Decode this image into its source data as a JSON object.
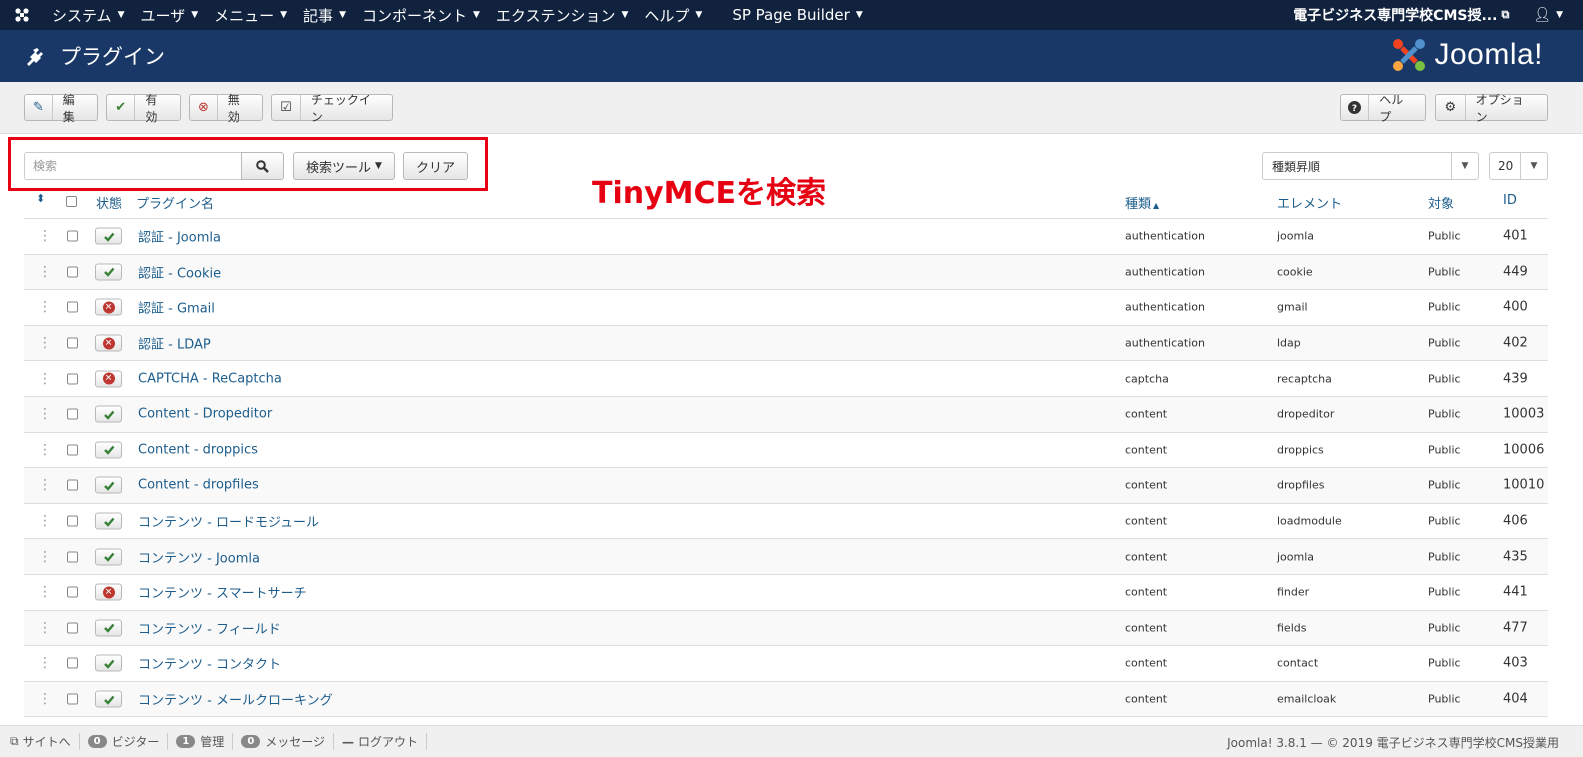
{
  "navbar": {
    "menu": [
      {
        "label": "システム"
      },
      {
        "label": "ユーザ"
      },
      {
        "label": "メニュー"
      },
      {
        "label": "記事"
      },
      {
        "label": "コンポーネント"
      },
      {
        "label": "エクステンション"
      },
      {
        "label": "ヘルプ"
      },
      {
        "label": "SP Page Builder"
      }
    ],
    "site_name": "電子ビジネス専門学校CMS授...",
    "colors": {
      "navbar": "#10223e",
      "header": "#1a3867"
    }
  },
  "header": {
    "title": "プラグイン",
    "logo_text": "Joomla!"
  },
  "toolbar": {
    "edit": "編集",
    "enable": "有効",
    "disable": "無効",
    "checkin": "チェックイン",
    "help": "ヘルプ",
    "options": "オプション"
  },
  "search": {
    "placeholder": "検索",
    "tools_label": "検索ツール",
    "clear_label": "クリア",
    "sort_value": "種類昇順",
    "limit_value": "20"
  },
  "annotation": {
    "text": "TinyMCEを検索",
    "color": "#e60012"
  },
  "table": {
    "headers": {
      "status": "状態",
      "name": "プラグイン名",
      "folder": "種類",
      "element": "エレメント",
      "access": "対象",
      "id": "ID"
    },
    "rows": [
      {
        "enabled": true,
        "name": "認証 - Joomla",
        "folder": "authentication",
        "element": "joomla",
        "access": "Public",
        "id": "401"
      },
      {
        "enabled": true,
        "name": "認証 - Cookie",
        "folder": "authentication",
        "element": "cookie",
        "access": "Public",
        "id": "449"
      },
      {
        "enabled": false,
        "name": "認証 - Gmail",
        "folder": "authentication",
        "element": "gmail",
        "access": "Public",
        "id": "400"
      },
      {
        "enabled": false,
        "name": "認証 - LDAP",
        "folder": "authentication",
        "element": "ldap",
        "access": "Public",
        "id": "402"
      },
      {
        "enabled": false,
        "name": "CAPTCHA - ReCaptcha",
        "folder": "captcha",
        "element": "recaptcha",
        "access": "Public",
        "id": "439"
      },
      {
        "enabled": true,
        "name": "Content - Dropeditor",
        "folder": "content",
        "element": "dropeditor",
        "access": "Public",
        "id": "10003"
      },
      {
        "enabled": true,
        "name": "Content - droppics",
        "folder": "content",
        "element": "droppics",
        "access": "Public",
        "id": "10006"
      },
      {
        "enabled": true,
        "name": "Content - dropfiles",
        "folder": "content",
        "element": "dropfiles",
        "access": "Public",
        "id": "10010"
      },
      {
        "enabled": true,
        "name": "コンテンツ - ロードモジュール",
        "folder": "content",
        "element": "loadmodule",
        "access": "Public",
        "id": "406"
      },
      {
        "enabled": true,
        "name": "コンテンツ - Joomla",
        "folder": "content",
        "element": "joomla",
        "access": "Public",
        "id": "435"
      },
      {
        "enabled": false,
        "name": "コンテンツ - スマートサーチ",
        "folder": "content",
        "element": "finder",
        "access": "Public",
        "id": "441"
      },
      {
        "enabled": true,
        "name": "コンテンツ - フィールド",
        "folder": "content",
        "element": "fields",
        "access": "Public",
        "id": "477"
      },
      {
        "enabled": true,
        "name": "コンテンツ - コンタクト",
        "folder": "content",
        "element": "contact",
        "access": "Public",
        "id": "403"
      },
      {
        "enabled": true,
        "name": "コンテンツ - メールクローキング",
        "folder": "content",
        "element": "emailcloak",
        "access": "Public",
        "id": "404"
      }
    ]
  },
  "footer": {
    "site_link": "サイトへ",
    "visitors_count": "0",
    "visitors_label": "ビジター",
    "admins_count": "1",
    "admins_label": "管理",
    "messages_count": "0",
    "messages_label": "メッセージ",
    "logout": "ログアウト",
    "version": "Joomla! 3.8.1 — © 2019 電子ビジネス専門学校CMS授業用"
  }
}
